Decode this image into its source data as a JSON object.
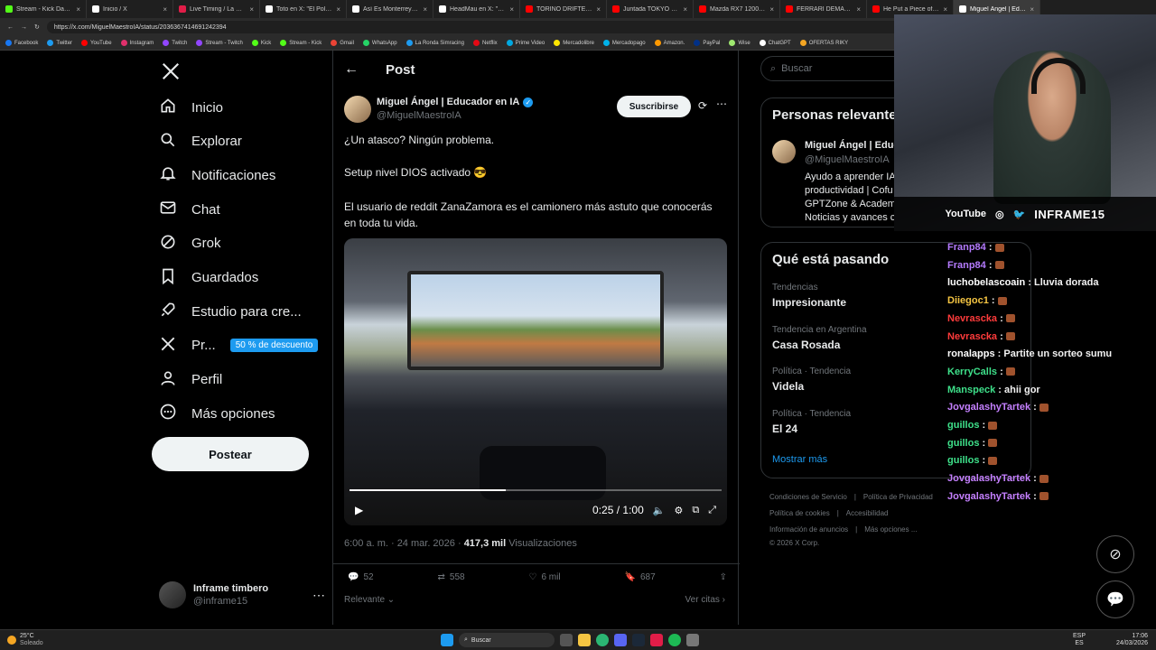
{
  "browser": {
    "tabs": [
      {
        "label": "Stream - Kick Dashboard",
        "color": "#53fc18"
      },
      {
        "label": "Inicio / X",
        "color": "#ffffff"
      },
      {
        "label": "Live Timing / La Ronda",
        "color": "#e11d48"
      },
      {
        "label": "Toto en X: \"El Pollo Vigno\"",
        "color": "#ffffff"
      },
      {
        "label": "Así Es Monterrey en X: \"...\"",
        "color": "#ffffff"
      },
      {
        "label": "HeadMau en X: \"@AsiEsM\"",
        "color": "#ffffff"
      },
      {
        "label": "TORINO DRIFTEANDO a...",
        "color": "#ff0000"
      },
      {
        "label": "Juntada TOKYO DRIFT en...",
        "color": "#ff0000"
      },
      {
        "label": "Mazda RX7 1200 HP Turbo",
        "color": "#ff0000"
      },
      {
        "label": "FERRARI DEMANDO A M...",
        "color": "#ff0000"
      },
      {
        "label": "He Put a Piece of Thread",
        "color": "#ff0000"
      },
      {
        "label": "Miguel Ángel | Educador",
        "color": "#ffffff",
        "active": true
      }
    ],
    "url": "https://x.com/MiguelMaestroIA/status/2036367414691242394",
    "bookmarks": [
      {
        "label": "Facebook",
        "color": "#1877f2"
      },
      {
        "label": "Twitter",
        "color": "#1d9bf0"
      },
      {
        "label": "YouTube",
        "color": "#ff0000"
      },
      {
        "label": "Instagram",
        "color": "#e1306c"
      },
      {
        "label": "Twitch",
        "color": "#9146ff"
      },
      {
        "label": "Stream - Twitch",
        "color": "#9146ff"
      },
      {
        "label": "Kick",
        "color": "#53fc18"
      },
      {
        "label": "Stream - Kick",
        "color": "#53fc18"
      },
      {
        "label": "Gmail",
        "color": "#ea4335"
      },
      {
        "label": "WhatsApp",
        "color": "#25d366"
      },
      {
        "label": "La Ronda Simracing",
        "color": "#1d9bf0"
      },
      {
        "label": "Netflix",
        "color": "#e50914"
      },
      {
        "label": "Prime Video",
        "color": "#00a8e1"
      },
      {
        "label": "Mercadolibre",
        "color": "#ffe600"
      },
      {
        "label": "Mercadopago",
        "color": "#00b1ea"
      },
      {
        "label": "Amazon.",
        "color": "#ff9900"
      },
      {
        "label": "PayPal",
        "color": "#003087"
      },
      {
        "label": "Wise",
        "color": "#9fe870"
      },
      {
        "label": "ChatGPT",
        "color": "#ffffff"
      },
      {
        "label": "OFERTAS RIKY",
        "color": "#f5a623"
      }
    ]
  },
  "nav": {
    "items": [
      {
        "label": "Inicio",
        "icon": "home-icon"
      },
      {
        "label": "Explorar",
        "icon": "search-icon"
      },
      {
        "label": "Notificaciones",
        "icon": "bell-icon"
      },
      {
        "label": "Chat",
        "icon": "mail-icon"
      },
      {
        "label": "Grok",
        "icon": "grok-icon"
      },
      {
        "label": "Guardados",
        "icon": "bookmark-icon"
      },
      {
        "label": "Estudio para cre...",
        "icon": "rocket-icon"
      },
      {
        "label": "Pr...",
        "icon": "x-icon"
      },
      {
        "label": "Perfil",
        "icon": "person-icon"
      },
      {
        "label": "Más opciones",
        "icon": "more-circle-icon"
      }
    ],
    "promo": "50 % de descuento",
    "post_button": "Postear",
    "account": {
      "name": "Inframe timbero",
      "handle": "@inframe15"
    }
  },
  "post": {
    "header": "Post",
    "author_name": "Miguel Ángel | Educador en IA",
    "author_handle": "@MiguelMaestroIA",
    "subscribe": "Suscribirse",
    "text1": "¿Un atasco? Ningún problema.",
    "text2": "Setup nivel DIOS activado 😎",
    "text3": "El usuario de reddit ZanaZamora es el camionero más astuto que conocerás en toda tu vida.",
    "video_time": "0:25 / 1:00",
    "video_progress": 0.42,
    "timestamp": "6:00 a. m. · 24 mar. 2026 · ",
    "views_count": "417,3 mil",
    "views_label": " Visualizaciones",
    "replies": "52",
    "reposts": "558",
    "likes": "6 mil",
    "bookmarks": "687",
    "sort": "Relevante",
    "quotes": "Ver citas"
  },
  "right": {
    "search_placeholder": "Buscar",
    "relevant_title": "Personas relevantes",
    "relevant_name": "Miguel Ángel | Educ",
    "relevant_handle": "@MiguelMaestroIA",
    "relevant_bio1": "Ayudo a aprender IA",
    "relevant_bio2": "productividad | Cofu",
    "relevant_bio3": "GPTZone & Academ",
    "relevant_bio4": "Noticias y avances c",
    "trends_title": "Qué está pasando",
    "trends": [
      {
        "cat": "Tendencias",
        "name": "Impresionante"
      },
      {
        "cat": "Tendencia en Argentina",
        "name": "Casa Rosada"
      },
      {
        "cat": "Política · Tendencia",
        "name": "Videla"
      },
      {
        "cat": "Política · Tendencia",
        "name": "El 24"
      }
    ],
    "show_more": "Mostrar más",
    "footer1": [
      "Condiciones de Servicio",
      "Política de Privacidad"
    ],
    "footer2": [
      "Política de cookies",
      "Accesibilidad"
    ],
    "footer3": [
      "Información de anuncios",
      "Más opciones ..."
    ],
    "copyright": "© 2026 X Corp."
  },
  "stream": {
    "socials": [
      "YouTube",
      "INFRAME15"
    ],
    "chat": [
      {
        "user": "Franp84",
        "color": "#b57bff",
        "msg": ""
      },
      {
        "user": "Franp84",
        "color": "#b57bff",
        "msg": ""
      },
      {
        "user": "luchobelascoain",
        "color": "#ffffff",
        "msg": "Lluvia dorada"
      },
      {
        "user": "Diiegoc1",
        "color": "#f5c542",
        "msg": ""
      },
      {
        "user": "Nevrascka",
        "color": "#ff3b3b",
        "msg": ""
      },
      {
        "user": "Nevrascka",
        "color": "#ff3b3b",
        "msg": ""
      },
      {
        "user": "ronalapps",
        "color": "#ffffff",
        "msg": "Partite un sorteo sumu"
      },
      {
        "user": "KerryCalls",
        "color": "#3ee08a",
        "msg": ""
      },
      {
        "user": "Manspeck",
        "color": "#3ee08a",
        "msg": "ahii gor"
      },
      {
        "user": "JovgalashyTartek",
        "color": "#c580ff",
        "msg": ""
      },
      {
        "user": "guillos",
        "color": "#3ee08a",
        "msg": ""
      },
      {
        "user": "guillos",
        "color": "#3ee08a",
        "msg": ""
      },
      {
        "user": "guillos",
        "color": "#3ee08a",
        "msg": ""
      },
      {
        "user": "JovgalashyTartek",
        "color": "#c580ff",
        "msg": ""
      },
      {
        "user": "JovgalashyTartek",
        "color": "#c580ff",
        "msg": ""
      }
    ]
  },
  "taskbar": {
    "weather_temp": "25°C",
    "weather_desc": "Soleado",
    "search": "Buscar",
    "lang1": "ESP",
    "lang2": "ES",
    "time": "17:06",
    "date": "24/03/2026"
  }
}
